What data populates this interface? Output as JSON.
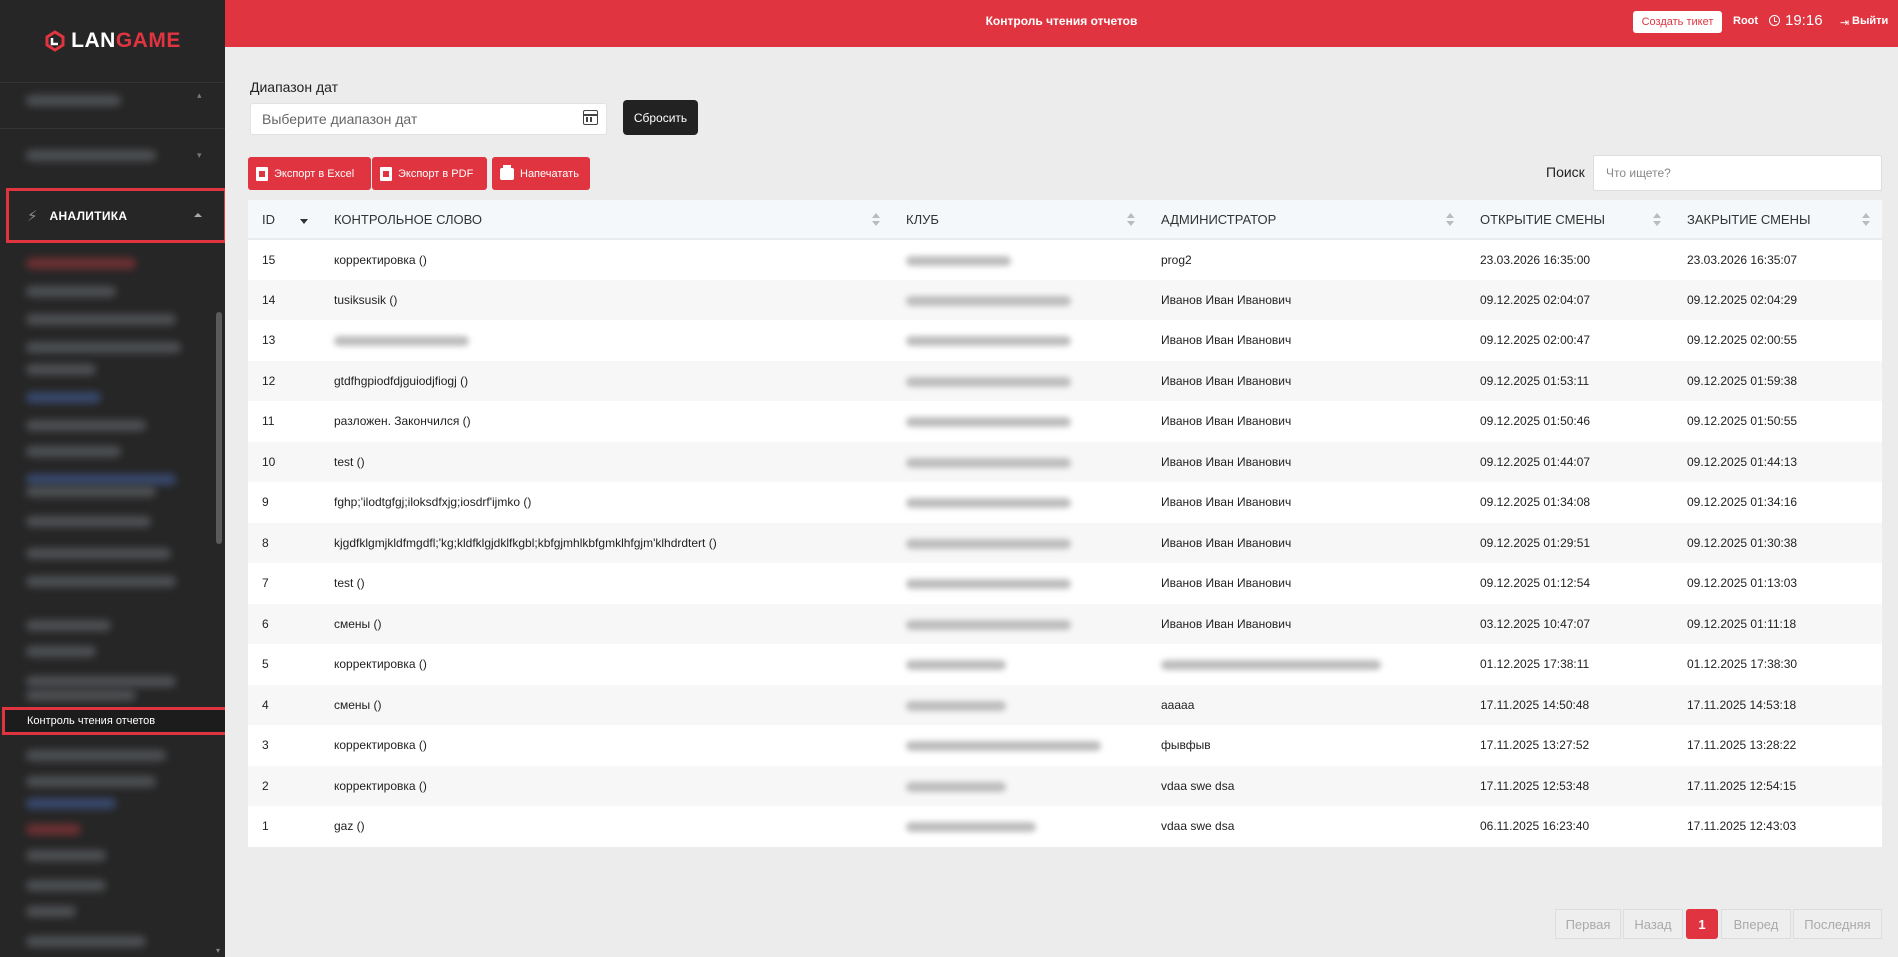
{
  "app": {
    "logo_left": "LAN",
    "logo_right": "GAME",
    "page_title": "Контроль чтения отчетов"
  },
  "topbar": {
    "ticket_label": "Создать тикет",
    "user": "Root",
    "time": "19:16",
    "logout_label": "Выйти"
  },
  "sidebar": {
    "section_label": "АНАЛИТИКА",
    "active_item": "Контроль чтения отчетов"
  },
  "filters": {
    "date_label": "Диапазон дат",
    "date_placeholder": "Выберите диапазон дат",
    "reset_label": "Сбросить",
    "export_excel": "Экспорт в Excel",
    "export_pdf": "Экспорт в PDF",
    "print_label": "Напечатать",
    "search_label": "Поиск",
    "search_placeholder": "Что ищете?"
  },
  "table": {
    "headers": [
      "ID",
      "КОНТРОЛЬНОЕ СЛОВО",
      "КЛУБ",
      "АДМИНИСТРАТОР",
      "ОТКРЫТИЕ СМЕНЫ",
      "ЗАКРЫТИЕ СМЕНЫ"
    ],
    "rows": [
      {
        "id": "15",
        "word": "корректировка ()",
        "admin": "prog2",
        "open": "23.03.2026 16:35:00",
        "close": "23.03.2026 16:35:07"
      },
      {
        "id": "14",
        "word": "tusiksusik ()",
        "admin": "Иванов Иван Иванович",
        "open": "09.12.2025 02:04:07",
        "close": "09.12.2025 02:04:29"
      },
      {
        "id": "13",
        "word": "",
        "admin": "Иванов Иван Иванович",
        "open": "09.12.2025 02:00:47",
        "close": "09.12.2025 02:00:55"
      },
      {
        "id": "12",
        "word": "gtdfhgpiodfdjguiodjfiogj ()",
        "admin": "Иванов Иван Иванович",
        "open": "09.12.2025 01:53:11",
        "close": "09.12.2025 01:59:38"
      },
      {
        "id": "11",
        "word": "разложен. Закончился ()",
        "admin": "Иванов Иван Иванович",
        "open": "09.12.2025 01:50:46",
        "close": "09.12.2025 01:50:55"
      },
      {
        "id": "10",
        "word": "test ()",
        "admin": "Иванов Иван Иванович",
        "open": "09.12.2025 01:44:07",
        "close": "09.12.2025 01:44:13"
      },
      {
        "id": "9",
        "word": "fghp;'ilodtgfgj;iloksdfxjg;iosdrf'ijmko ()",
        "admin": "Иванов Иван Иванович",
        "open": "09.12.2025 01:34:08",
        "close": "09.12.2025 01:34:16"
      },
      {
        "id": "8",
        "word": "kjgdfklgmjkldfmgdfl;'kg;kldfklgjdklfkgbl;kbfgjmhlkbfgmklhfgjm'klhdrdtert ()",
        "admin": "Иванов Иван Иванович",
        "open": "09.12.2025 01:29:51",
        "close": "09.12.2025 01:30:38"
      },
      {
        "id": "7",
        "word": "test ()",
        "admin": "Иванов Иван Иванович",
        "open": "09.12.2025 01:12:54",
        "close": "09.12.2025 01:13:03"
      },
      {
        "id": "6",
        "word": "смены ()",
        "admin": "Иванов Иван Иванович",
        "open": "03.12.2025 10:47:07",
        "close": "09.12.2025 01:11:18"
      },
      {
        "id": "5",
        "word": "корректировка ()",
        "admin": "",
        "open": "01.12.2025 17:38:11",
        "close": "01.12.2025 17:38:30"
      },
      {
        "id": "4",
        "word": "смены ()",
        "admin": "aaaaa",
        "open": "17.11.2025 14:50:48",
        "close": "17.11.2025 14:53:18"
      },
      {
        "id": "3",
        "word": "корректировка ()",
        "admin": "фывфыв",
        "open": "17.11.2025 13:27:52",
        "close": "17.11.2025 13:28:22"
      },
      {
        "id": "2",
        "word": "корректировка ()",
        "admin": "vdaa swe dsa",
        "open": "17.11.2025 12:53:48",
        "close": "17.11.2025 12:54:15"
      },
      {
        "id": "1",
        "word": "gaz ()",
        "admin": "vdaa swe dsa",
        "open": "06.11.2025 16:23:40",
        "close": "17.11.2025 12:43:03"
      }
    ]
  },
  "pagination": {
    "first": "Первая",
    "prev": "Назад",
    "current": "1",
    "next": "Вперед",
    "last": "Последняя"
  },
  "colors": {
    "accent": "#e03440",
    "sidebar_bg": "#262626",
    "page_bg": "#ececec"
  }
}
